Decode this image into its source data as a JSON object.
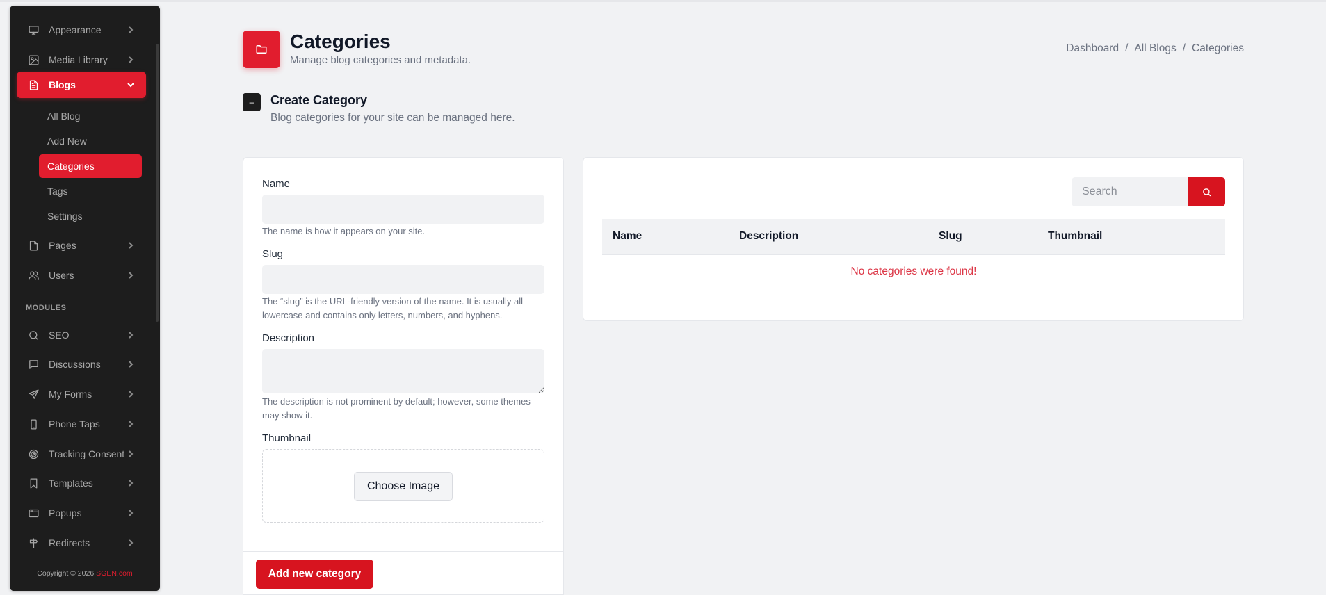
{
  "sidebar": {
    "items": [
      {
        "label": "Appearance",
        "icon": "monitor-icon"
      },
      {
        "label": "Media Library",
        "icon": "image-icon"
      },
      {
        "label": "Blogs",
        "icon": "document-icon",
        "active": true
      },
      {
        "label": "Pages",
        "icon": "file-icon"
      },
      {
        "label": "Users",
        "icon": "users-icon"
      }
    ],
    "blog_sub": [
      {
        "label": "All Blog"
      },
      {
        "label": "Add New"
      },
      {
        "label": "Categories",
        "active": true
      },
      {
        "label": "Tags"
      },
      {
        "label": "Settings"
      }
    ],
    "modules_label": "MODULES",
    "modules": [
      {
        "label": "SEO",
        "icon": "search-icon"
      },
      {
        "label": "Discussions",
        "icon": "chat-icon"
      },
      {
        "label": "My Forms",
        "icon": "send-icon"
      },
      {
        "label": "Phone Taps",
        "icon": "phone-icon"
      },
      {
        "label": "Tracking Consent",
        "icon": "target-icon"
      },
      {
        "label": "Templates",
        "icon": "bookmark-icon"
      },
      {
        "label": "Popups",
        "icon": "window-icon"
      },
      {
        "label": "Redirects",
        "icon": "signpost-icon"
      }
    ],
    "footer": {
      "text": "Copyright © 2026",
      "brand": "SGEN.com"
    }
  },
  "header": {
    "title": "Categories",
    "subtitle": "Manage blog categories and metadata.",
    "breadcrumb": [
      "Dashboard",
      "All Blogs",
      "Categories"
    ],
    "separator": "/"
  },
  "section": {
    "badge": "–",
    "title": "Create Category",
    "subtitle": "Blog categories for your site can be managed here."
  },
  "form": {
    "name_label": "Name",
    "name_value": "",
    "name_help": "The name is how it appears on your site.",
    "slug_label": "Slug",
    "slug_value": "",
    "slug_help": "The “slug” is the URL-friendly version of the name. It is usually all lowercase and contains only letters, numbers, and hyphens.",
    "description_label": "Description",
    "description_value": "",
    "description_help": "The description is not prominent by default; however, some themes may show it.",
    "thumbnail_label": "Thumbnail",
    "choose_image": "Choose Image",
    "submit": "Add new category"
  },
  "table": {
    "search_placeholder": "Search",
    "columns": [
      "Name",
      "Description",
      "Slug",
      "Thumbnail"
    ],
    "empty_message": "No categories were found!"
  },
  "colors": {
    "accent": "#e11d2e",
    "sidebar_bg": "#1d1d1d",
    "page_bg": "#f1f2f4",
    "empty_text": "#dc3545"
  }
}
